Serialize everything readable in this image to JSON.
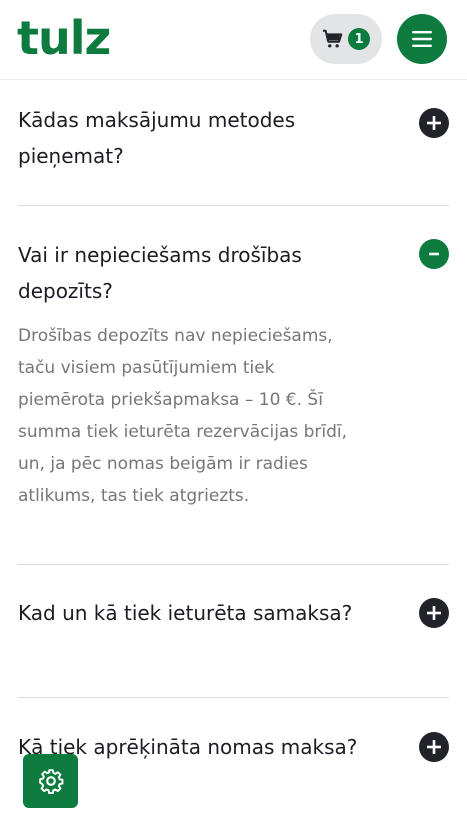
{
  "header": {
    "logo_text": "tulz",
    "cart_count": "1",
    "brand_color": "#0d7a3e"
  },
  "faq": {
    "items": [
      {
        "question": "Kādas maksājumu metodes pieņemat?",
        "expanded": false,
        "toggle_icon": "plus-icon"
      },
      {
        "question": "Vai ir nepieciešams drošības depozīts?",
        "expanded": true,
        "toggle_icon": "minus-icon",
        "answer": "Drošības depozīts nav nepieciešams, taču visiem pasūtījumiem tiek piemērota priekšapmaksa – 10 €. Šī summa tiek ieturēta rezervācijas brīdī, un, ja pēc nomas beigām ir radies atlikums, tas tiek atgriezts."
      },
      {
        "question": "Kad un kā tiek ieturēta samaksa?",
        "expanded": false,
        "toggle_icon": "plus-icon"
      },
      {
        "question": "Kā tiek aprēķināta nomas maksa?",
        "expanded": false,
        "toggle_icon": "plus-icon"
      }
    ]
  },
  "floating": {
    "settings_icon": "gear-icon"
  }
}
